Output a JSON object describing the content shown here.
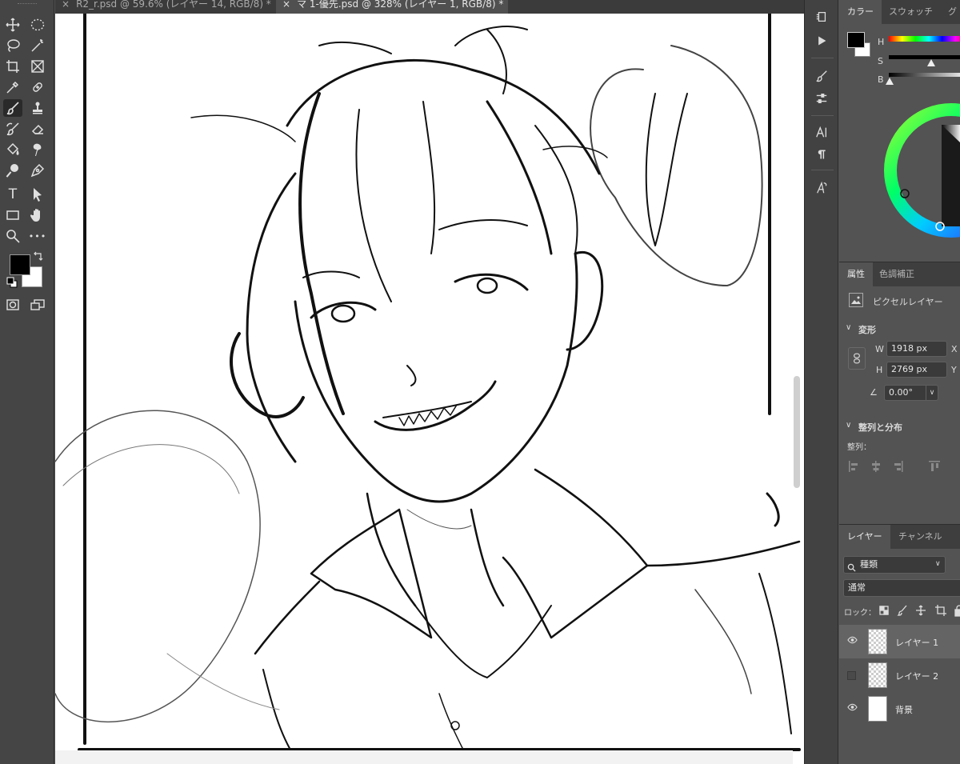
{
  "tabs": [
    {
      "label": "R2_r.psd @ 59.6% (レイヤー 14, RGB/8) *",
      "close": "×",
      "active": false
    },
    {
      "label": "マ 1-優先.psd @ 328% (レイヤー 1, RGB/8) *",
      "close": "×",
      "active": true
    }
  ],
  "toolbar": {
    "tools": [
      "move-tool",
      "marquee-tool",
      "lasso-tool",
      "magic-wand-tool",
      "crop-tool",
      "frame-tool",
      "eyedropper-tool",
      "healing-brush-tool",
      "brush-tool",
      "clone-stamp-tool",
      "history-brush-tool",
      "eraser-tool",
      "paint-bucket-tool",
      "smudge-tool",
      "dodge-tool",
      "pen-tool",
      "type-tool",
      "path-selection-tool",
      "rectangle-tool",
      "hand-tool",
      "zoom-tool",
      "more-tools"
    ],
    "type_glyph": "T",
    "more_glyph": "•••",
    "foreground_color": "#000000",
    "background_color": "#ffffff"
  },
  "color_panel": {
    "tabs": [
      "カラー",
      "スウォッチ",
      "グ"
    ],
    "sliders": [
      {
        "label": "H",
        "value": 0
      },
      {
        "label": "S",
        "value": 0
      },
      {
        "label": "B",
        "value": 0
      }
    ]
  },
  "properties_panel": {
    "tabs": [
      "属性",
      "色調補正"
    ],
    "layer_type": "ピクセルレイヤー",
    "transform_section": "変形",
    "w_label": "W",
    "w_value": "1918 px",
    "x_label": "X",
    "h_label": "H",
    "h_value": "2769 px",
    "y_label": "Y",
    "angle_value": "0.00°",
    "align_section": "整列と分布",
    "align_label": "整列："
  },
  "layers_panel": {
    "tabs": [
      "レイヤー",
      "チャンネル"
    ],
    "filter_kind": "種類",
    "blend_mode": "通常",
    "lock_label": "ロック：",
    "layers": [
      {
        "name": "レイヤー 1",
        "visible": true,
        "selected": true
      },
      {
        "name": "レイヤー 2",
        "visible": false,
        "selected": false
      },
      {
        "name": "背景",
        "visible": true,
        "selected": false
      }
    ]
  }
}
